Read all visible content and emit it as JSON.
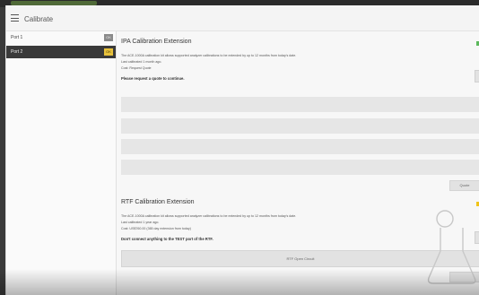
{
  "app": {
    "title": "Calibrate"
  },
  "sidebar": {
    "ports": [
      {
        "label": "Port 1",
        "badge": "OK",
        "badge_color": "#8a8a8a",
        "selected": false
      },
      {
        "label": "Port 2",
        "badge": "OK",
        "badge_color": "#e8c23c",
        "selected": true
      }
    ]
  },
  "ipa": {
    "title": "IPA Calibration Extension",
    "description": "The ACE-1000A calibration kit allows supported analyzer calibrations to be extended by up to 12 months from today's date.",
    "last_calibrated": "Last calibrated 1 month ago.",
    "cost": "Cost: Request Quote",
    "instruction": "Please request a quote to continue.",
    "quote_button": "Quote",
    "status_color": "#5cb85c"
  },
  "rtf": {
    "title": "RTF Calibration Extension",
    "description": "The ACE-1000A calibration kit allows supported analyzer calibrations to be extended by up to 12 months from today's date.",
    "last_calibrated": "Last calibrated 1 year ago.",
    "cost": "Cost: US$760.00 (365 day extension from today)",
    "instruction": "Don't connect anything to the TEST port of the RTF.",
    "test_button": "RTF Open Circuit",
    "status_color": "#f0c419"
  },
  "icons": [
    "hamburger-icon",
    "flask-icon"
  ]
}
